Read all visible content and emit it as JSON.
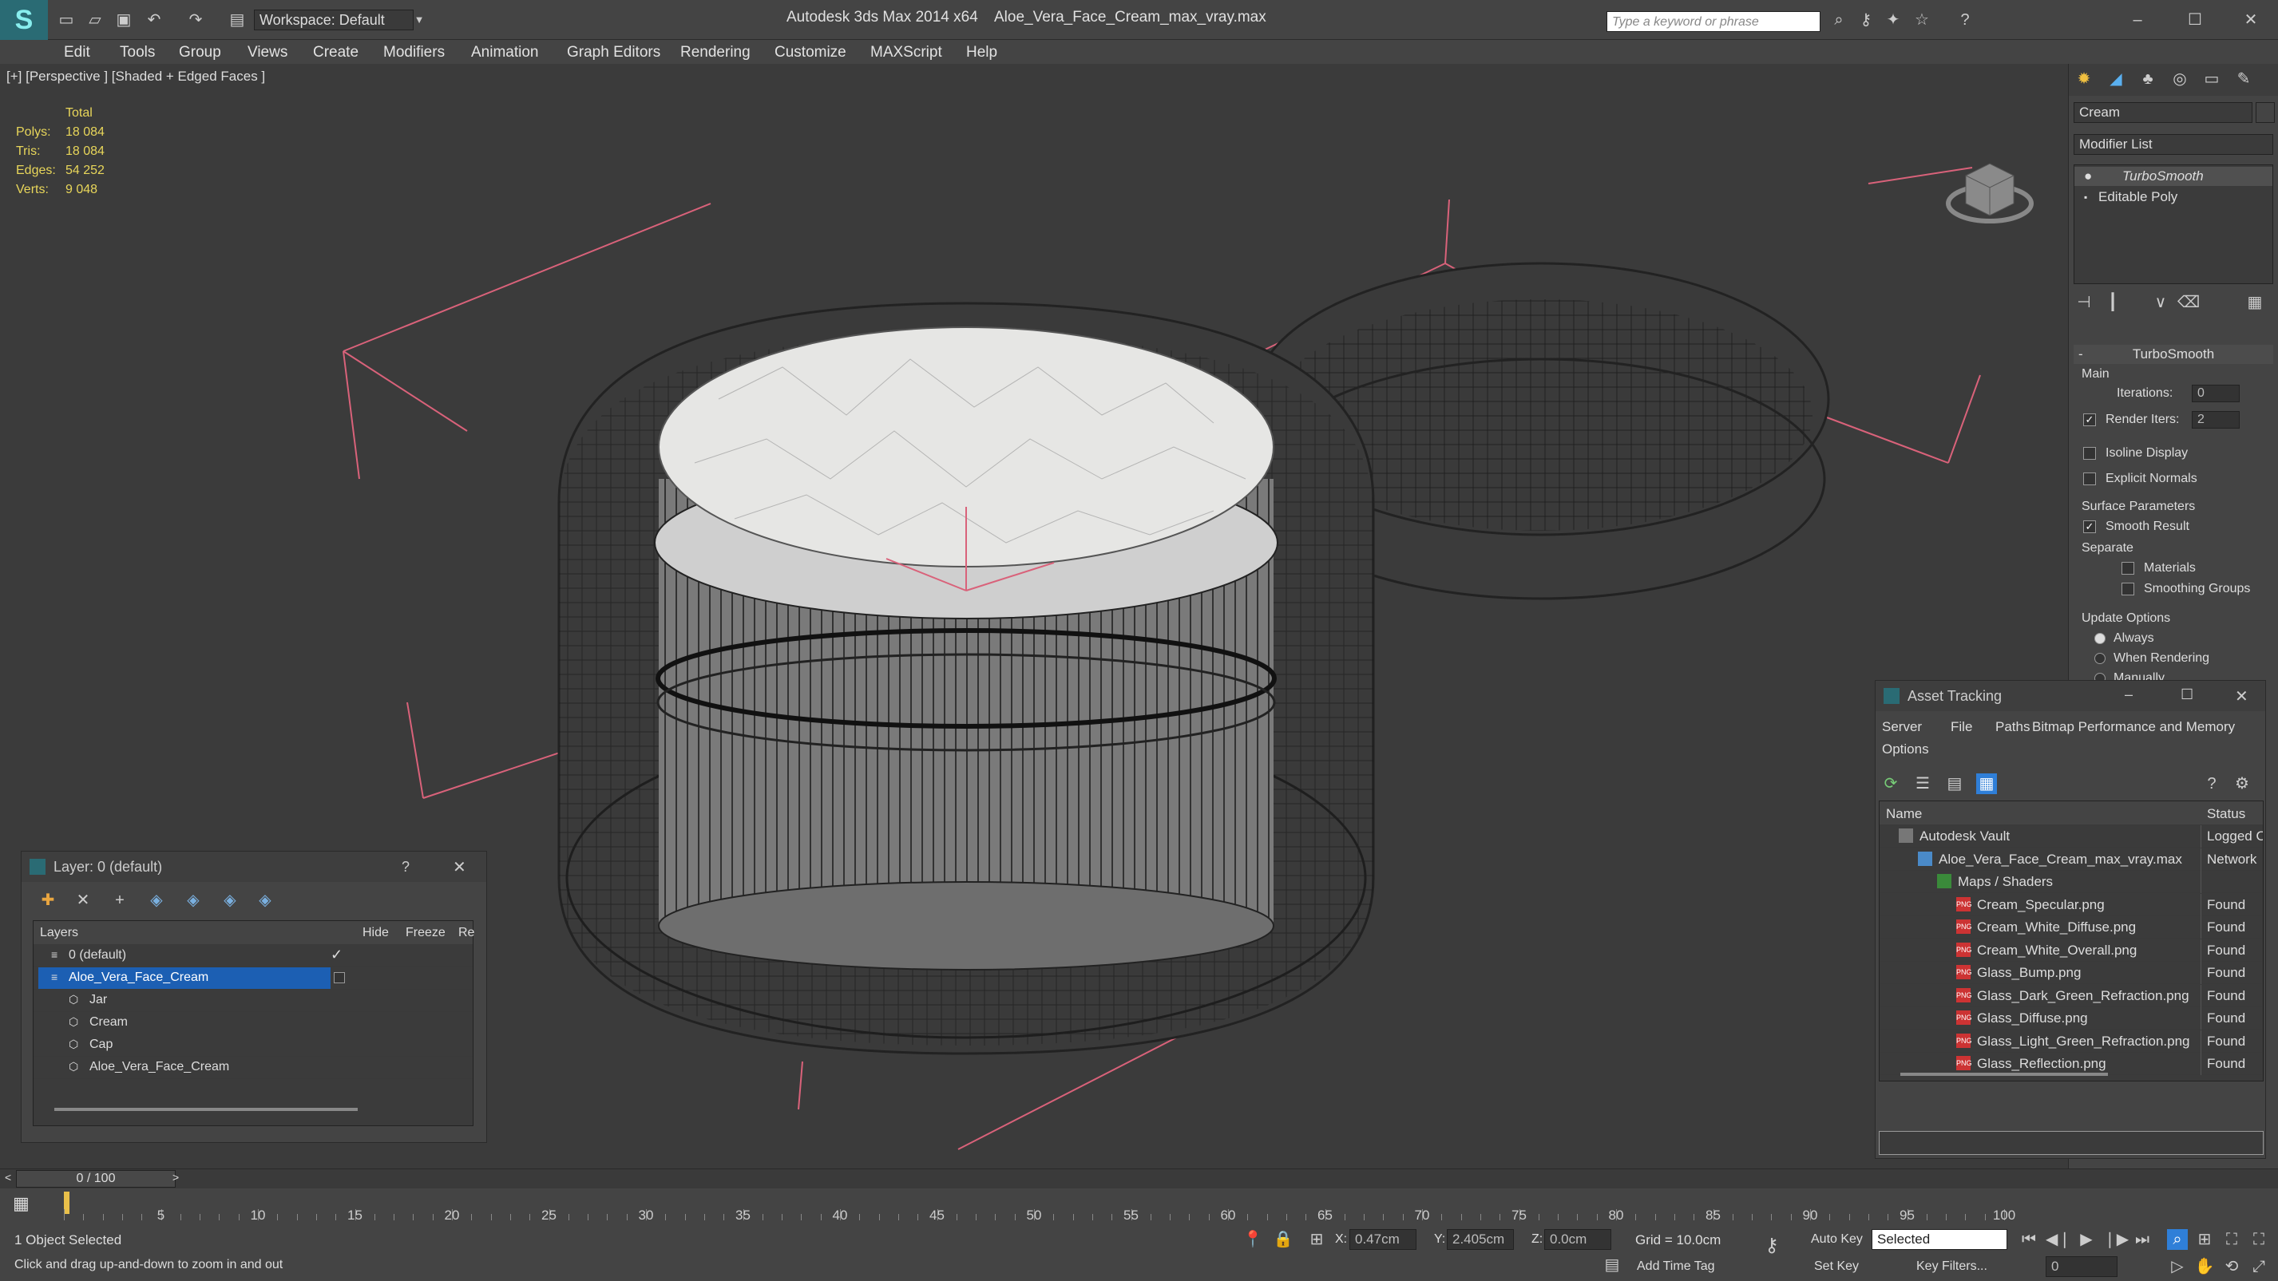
{
  "app": {
    "title": "Autodesk 3ds Max  2014 x64",
    "file": "Aloe_Vera_Face_Cream_max_vray.max",
    "workspace": "Workspace: Default",
    "search_placeholder": "Type a keyword or phrase"
  },
  "menu": [
    "Edit",
    "Tools",
    "Group",
    "Views",
    "Create",
    "Modifiers",
    "Animation",
    "Graph Editors",
    "Rendering",
    "Customize",
    "MAXScript",
    "Help"
  ],
  "viewport": {
    "label": "[+] [Perspective ] [Shaded + Edged Faces ]",
    "stats": {
      "header": "Total",
      "rows": [
        {
          "k": "Polys:",
          "v": "18 084"
        },
        {
          "k": "Tris:",
          "v": "18 084"
        },
        {
          "k": "Edges:",
          "v": "54 252"
        },
        {
          "k": "Verts:",
          "v": "9 048"
        }
      ]
    }
  },
  "command_panel": {
    "object_name": "Cream",
    "modifier_list": "Modifier List",
    "stack": [
      "TurboSmooth",
      "Editable Poly"
    ],
    "rollout": "TurboSmooth",
    "main": "Main",
    "iterations_label": "Iterations:",
    "iterations": "0",
    "render_iters_label": "Render Iters:",
    "render_iters": "2",
    "isoline": "Isoline Display",
    "explicit": "Explicit Normals",
    "surface": "Surface Parameters",
    "smooth": "Smooth Result",
    "separate": "Separate",
    "materials": "Materials",
    "smoothing": "Smoothing Groups",
    "update": "Update Options",
    "always": "Always",
    "when_rendering": "When Rendering",
    "manually": "Manually"
  },
  "layer_window": {
    "title": "Layer: 0 (default)",
    "help": "?",
    "cols": {
      "layers": "Layers",
      "hide": "Hide",
      "freeze": "Freeze",
      "re": "Re"
    },
    "rows": [
      {
        "name": "0 (default)",
        "indent": 0
      },
      {
        "name": "Aloe_Vera_Face_Cream",
        "indent": 0
      },
      {
        "name": "Jar",
        "indent": 1
      },
      {
        "name": "Cream",
        "indent": 1
      },
      {
        "name": "Cap",
        "indent": 1
      },
      {
        "name": "Aloe_Vera_Face_Cream",
        "indent": 1
      }
    ]
  },
  "asset_window": {
    "title": "Asset Tracking",
    "menu": [
      "Server",
      "File",
      "Paths",
      "Bitmap Performance and Memory",
      "Options"
    ],
    "cols": {
      "name": "Name",
      "status": "Status"
    },
    "rows": [
      {
        "name": "Autodesk Vault",
        "status": "Logged O",
        "indent": 0,
        "kind": "vault"
      },
      {
        "name": "Aloe_Vera_Face_Cream_max_vray.max",
        "status": "Network",
        "indent": 1,
        "kind": "max"
      },
      {
        "name": "Maps / Shaders",
        "status": "",
        "indent": 2,
        "kind": "maps"
      },
      {
        "name": "Cream_Specular.png",
        "status": "Found",
        "indent": 3,
        "kind": "png"
      },
      {
        "name": "Cream_White_Diffuse.png",
        "status": "Found",
        "indent": 3,
        "kind": "png"
      },
      {
        "name": "Cream_White_Overall.png",
        "status": "Found",
        "indent": 3,
        "kind": "png"
      },
      {
        "name": "Glass_Bump.png",
        "status": "Found",
        "indent": 3,
        "kind": "png"
      },
      {
        "name": "Glass_Dark_Green_Refraction.png",
        "status": "Found",
        "indent": 3,
        "kind": "png"
      },
      {
        "name": "Glass_Diffuse.png",
        "status": "Found",
        "indent": 3,
        "kind": "png"
      },
      {
        "name": "Glass_Light_Green_Refraction.png",
        "status": "Found",
        "indent": 3,
        "kind": "png"
      },
      {
        "name": "Glass_Reflection.png",
        "status": "Found",
        "indent": 3,
        "kind": "png"
      }
    ],
    "png_badge": "PNG"
  },
  "timeline": {
    "frame": "0 / 100",
    "ticks": [
      "5",
      "10",
      "15",
      "20",
      "25",
      "30",
      "35",
      "40",
      "45",
      "50",
      "55",
      "60",
      "65",
      "70",
      "75",
      "80",
      "85",
      "90",
      "95",
      "100"
    ]
  },
  "status": {
    "selected": "1 Object Selected",
    "hint": "Click and drag up-and-down to zoom in and out",
    "x_label": "X:",
    "x": "0.47cm",
    "y_label": "Y:",
    "y": "2.405cm",
    "z_label": "Z:",
    "z": "0.0cm",
    "grid": "Grid = 10.0cm",
    "add_time_tag": "Add Time Tag",
    "auto_key": "Auto Key",
    "set_key": "Set Key",
    "selected_dd": "Selected",
    "key_filters": "Key Filters...",
    "frame_field": "0"
  },
  "colors": {
    "accent": "#2f7fd8",
    "selection": "#1c5fb3",
    "stats_yellow": "#e8d65a",
    "wire_pink": "#d9627a"
  }
}
